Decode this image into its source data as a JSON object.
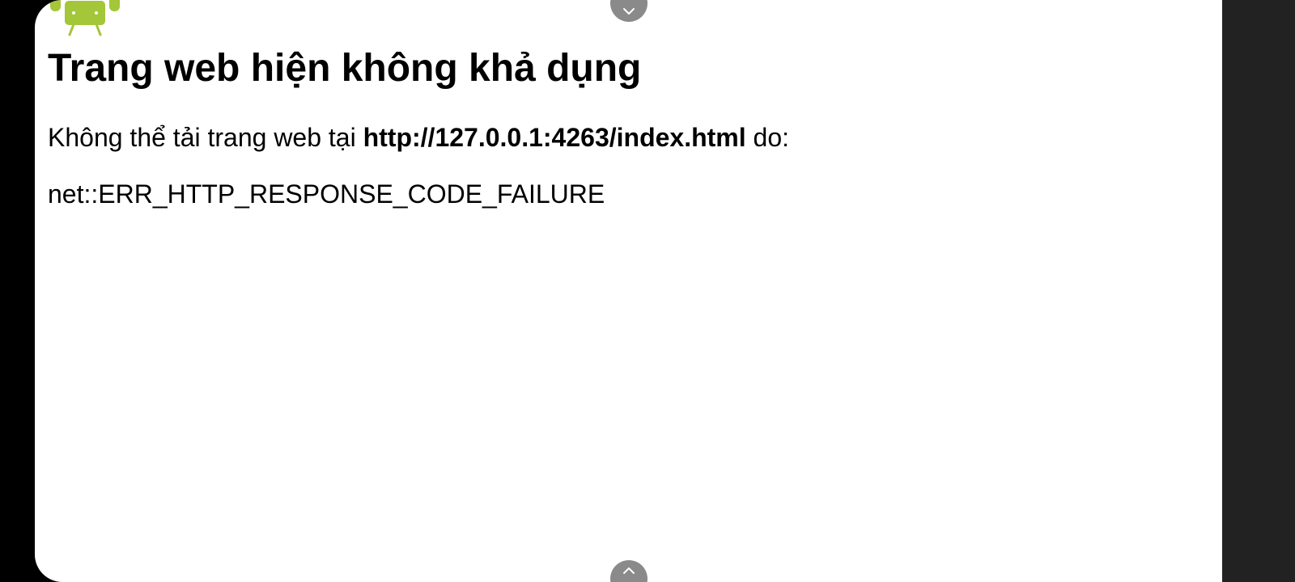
{
  "error_page": {
    "title": "Trang web hiện không khả dụng",
    "message_prefix": "Không thể tải trang web tại ",
    "url": "http://127.0.0.1:4263/index.html",
    "message_suffix": " do:",
    "error_code": "net::ERR_HTTP_RESPONSE_CODE_FAILURE"
  },
  "icons": {
    "logo": "android-robot-icon",
    "scroll_up": "chevron-down-icon",
    "scroll_down": "chevron-up-icon"
  },
  "colors": {
    "android_green": "#A4C639",
    "page_background": "#FFFFFF",
    "text": "#000000",
    "side_panel": "#222222",
    "scroll_handle": "#8A8A8A"
  }
}
